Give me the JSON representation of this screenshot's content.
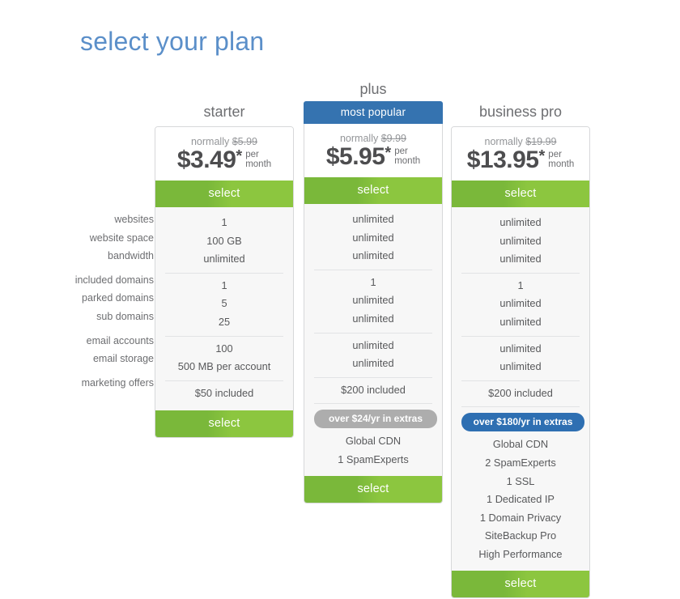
{
  "page": {
    "title": "select your plan"
  },
  "feature_labels": [
    [
      "websites",
      "website space",
      "bandwidth"
    ],
    [
      "included domains",
      "parked domains",
      "sub domains"
    ],
    [
      "email accounts",
      "email storage"
    ],
    [
      "marketing offers"
    ]
  ],
  "select_label": "select",
  "plans": [
    {
      "id": "starter",
      "name": "starter",
      "badge": null,
      "normally_prefix": "normally",
      "normally_price": "$5.99",
      "price": "$3.49",
      "star": "*",
      "per": "per",
      "month": "month",
      "top_select": "select",
      "bottom_select": "select",
      "features": [
        [
          "1",
          "100 GB",
          "unlimited"
        ],
        [
          "1",
          "5",
          "25"
        ],
        [
          "100",
          "500 MB per account"
        ],
        [
          "$50 included"
        ]
      ],
      "extras_badge": null,
      "extras": []
    },
    {
      "id": "plus",
      "name": "plus",
      "badge": "most popular",
      "normally_prefix": "normally",
      "normally_price": "$9.99",
      "price": "$5.95",
      "star": "*",
      "per": "per",
      "month": "month",
      "top_select": "select",
      "bottom_select": "select",
      "features": [
        [
          "unlimited",
          "unlimited",
          "unlimited"
        ],
        [
          "1",
          "unlimited",
          "unlimited"
        ],
        [
          "unlimited",
          "unlimited"
        ],
        [
          "$200 included"
        ]
      ],
      "extras_badge": "over $24/yr in extras",
      "extras": [
        "Global CDN",
        "1 SpamExperts"
      ]
    },
    {
      "id": "business-pro",
      "name": "business pro",
      "badge": null,
      "normally_prefix": "normally",
      "normally_price": "$19.99",
      "price": "$13.95",
      "star": "*",
      "per": "per",
      "month": "month",
      "top_select": "select",
      "bottom_select": "select",
      "features": [
        [
          "unlimited",
          "unlimited",
          "unlimited"
        ],
        [
          "1",
          "unlimited",
          "unlimited"
        ],
        [
          "unlimited",
          "unlimited"
        ],
        [
          "$200 included"
        ]
      ],
      "extras_badge": "over $180/yr in extras",
      "extras": [
        "Global CDN",
        "2 SpamExperts",
        "1 SSL",
        "1 Dedicated IP",
        "1 Domain Privacy",
        "SiteBackup Pro",
        "High Performance"
      ]
    }
  ],
  "colors": {
    "title_blue": "#5b8fc9",
    "banner_blue": "#3573b0",
    "select_green": "#7ab83a",
    "badge_gray": "#adadad",
    "badge_blue": "#2e6fb2"
  }
}
